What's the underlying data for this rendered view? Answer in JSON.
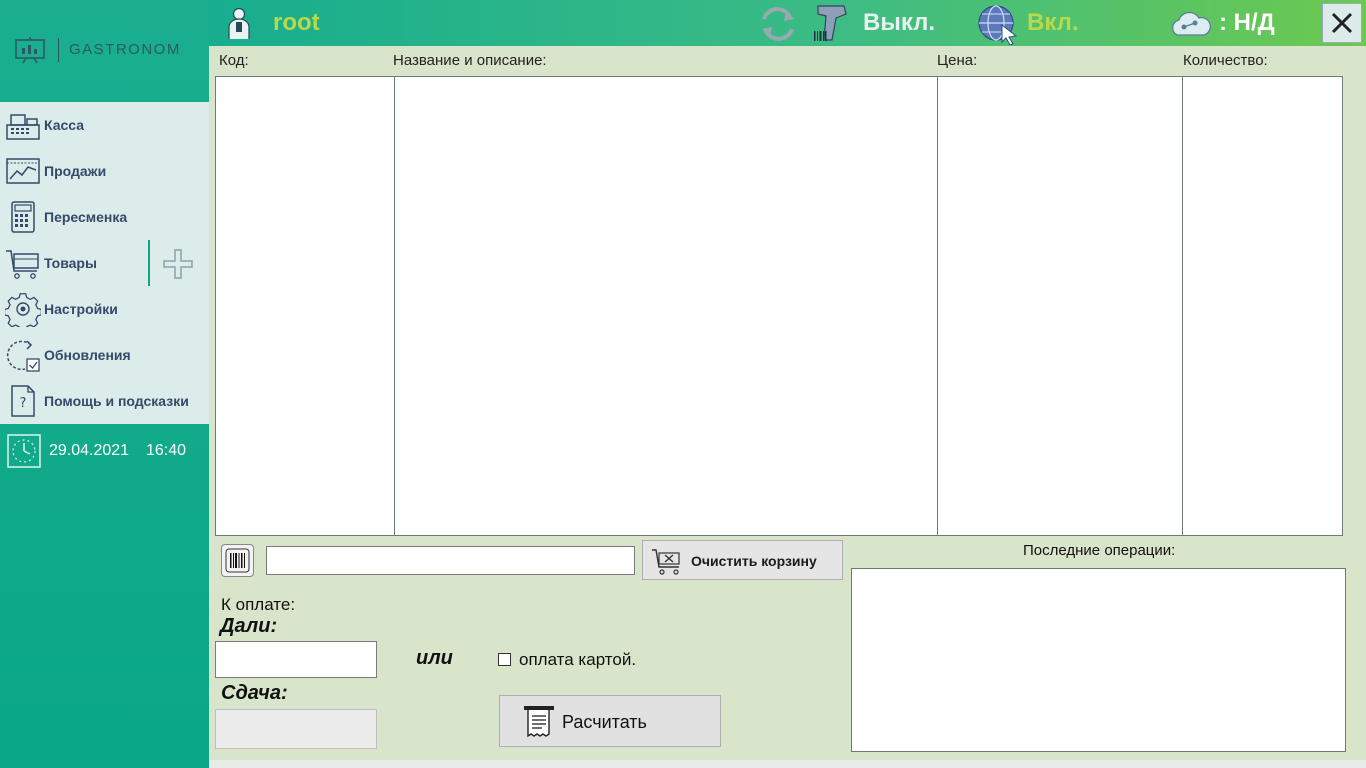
{
  "app": {
    "logo_text": "GASTRONOM"
  },
  "menu": {
    "items": [
      {
        "label": "Касса",
        "icon": "cash-register-icon"
      },
      {
        "label": "Продажи",
        "icon": "sales-chart-icon"
      },
      {
        "label": "Пересменка",
        "icon": "calculator-icon"
      },
      {
        "label": "Товары",
        "icon": "goods-cart-icon"
      },
      {
        "label": "Настройки",
        "icon": "gear-icon"
      },
      {
        "label": "Обновления",
        "icon": "update-icon"
      },
      {
        "label": "Помощь и подсказки",
        "icon": "help-document-icon"
      }
    ],
    "add_goods_icon": "plus-icon"
  },
  "clock": {
    "date": "29.04.2021",
    "time": "16:40"
  },
  "topbar": {
    "user": "root",
    "scanner_status": "Выкл.",
    "web_status": "Вкл.",
    "cloud_status": ": Н/Д",
    "close_icon": "close-icon"
  },
  "table": {
    "columns": [
      "Код:",
      "Название и описание:",
      "Цена:",
      "Количество:"
    ],
    "rows": []
  },
  "checkout": {
    "barcode_value": "",
    "clear_cart_label": "Очистить корзину",
    "to_pay_label": "К оплате:",
    "given_label": "Дали:",
    "given_value": "",
    "or_label": "или",
    "card_payment_label": "оплата картой.",
    "card_payment_checked": false,
    "change_label": "Сдача:",
    "change_value": "",
    "pay_button_label": "Расчитать"
  },
  "operations": {
    "label": "Последние операции:",
    "items": []
  },
  "colors": {
    "sidebar": "#0aa888",
    "menu_bg": "#dcecea",
    "menu_text": "#354a6b",
    "accent_green": "#b9d94a",
    "content_bg": "#d9e5cb"
  }
}
